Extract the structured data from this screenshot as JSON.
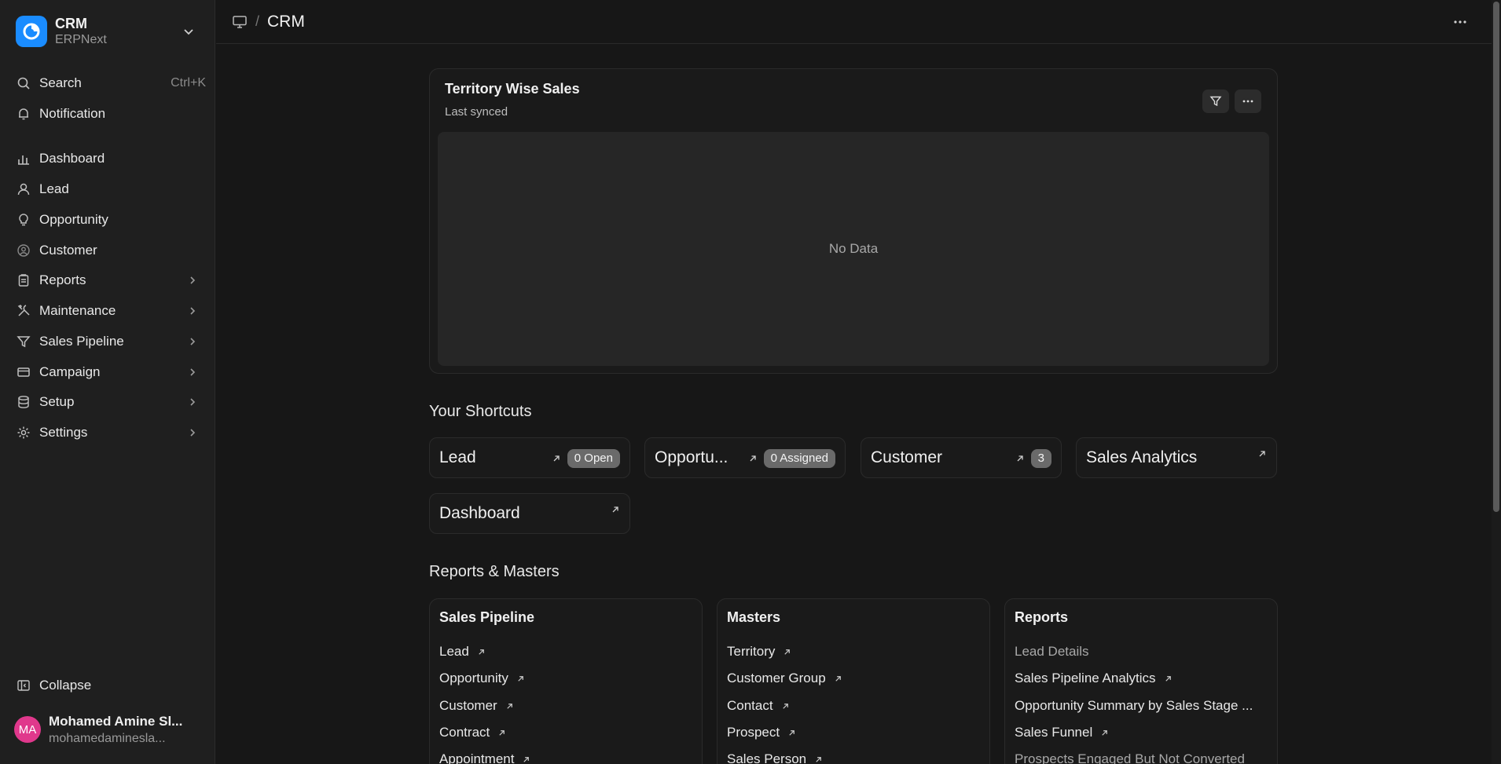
{
  "app": {
    "name": "CRM",
    "subtitle": "ERPNext"
  },
  "sidebar": {
    "search": {
      "label": "Search",
      "shortcut": "Ctrl+K"
    },
    "notification": {
      "label": "Notification"
    },
    "items": [
      {
        "label": "Dashboard",
        "icon": "bar-chart-icon"
      },
      {
        "label": "Lead",
        "icon": "user-icon"
      },
      {
        "label": "Opportunity",
        "icon": "lightbulb-icon"
      },
      {
        "label": "Customer",
        "icon": "user-circle-icon"
      },
      {
        "label": "Reports",
        "icon": "clipboard-icon"
      },
      {
        "label": "Maintenance",
        "icon": "tools-icon"
      },
      {
        "label": "Sales Pipeline",
        "icon": "filter-icon"
      },
      {
        "label": "Campaign",
        "icon": "card-icon"
      },
      {
        "label": "Setup",
        "icon": "database-icon"
      },
      {
        "label": "Settings",
        "icon": "gear-icon"
      }
    ],
    "collapse": "Collapse",
    "user": {
      "initials": "MA",
      "name": "Mohamed Amine Sl...",
      "email": "mohamedaminesla..."
    }
  },
  "header": {
    "breadcrumb_separator": "/",
    "title": "CRM"
  },
  "chart_card": {
    "title": "Territory Wise Sales",
    "subtitle": "Last synced",
    "empty_text": "No Data"
  },
  "shortcuts": {
    "heading": "Your Shortcuts",
    "items": [
      {
        "label": "Lead",
        "badge": "0 Open"
      },
      {
        "label": "Opportu...",
        "badge": "0 Assigned"
      },
      {
        "label": "Customer",
        "badge": "3"
      },
      {
        "label": "Sales Analytics",
        "badge": ""
      },
      {
        "label": "Dashboard",
        "badge": ""
      }
    ]
  },
  "reports_masters": {
    "heading": "Reports & Masters",
    "cards": [
      {
        "title": "Sales Pipeline",
        "links": [
          "Lead",
          "Opportunity",
          "Customer",
          "Contract",
          "Appointment"
        ]
      },
      {
        "title": "Masters",
        "links": [
          "Territory",
          "Customer Group",
          "Contact",
          "Prospect",
          "Sales Person"
        ]
      },
      {
        "title": "Reports",
        "links": [
          "Lead Details",
          "Sales Pipeline Analytics",
          "Opportunity Summary by Sales Stage ...",
          "Sales Funnel",
          "Prospects Engaged But Not Converted"
        ]
      }
    ]
  },
  "colors": {
    "accent": "#1a8cff",
    "avatar": "#e0388c",
    "background": "#171717",
    "sidebar": "#1f1f1f"
  }
}
